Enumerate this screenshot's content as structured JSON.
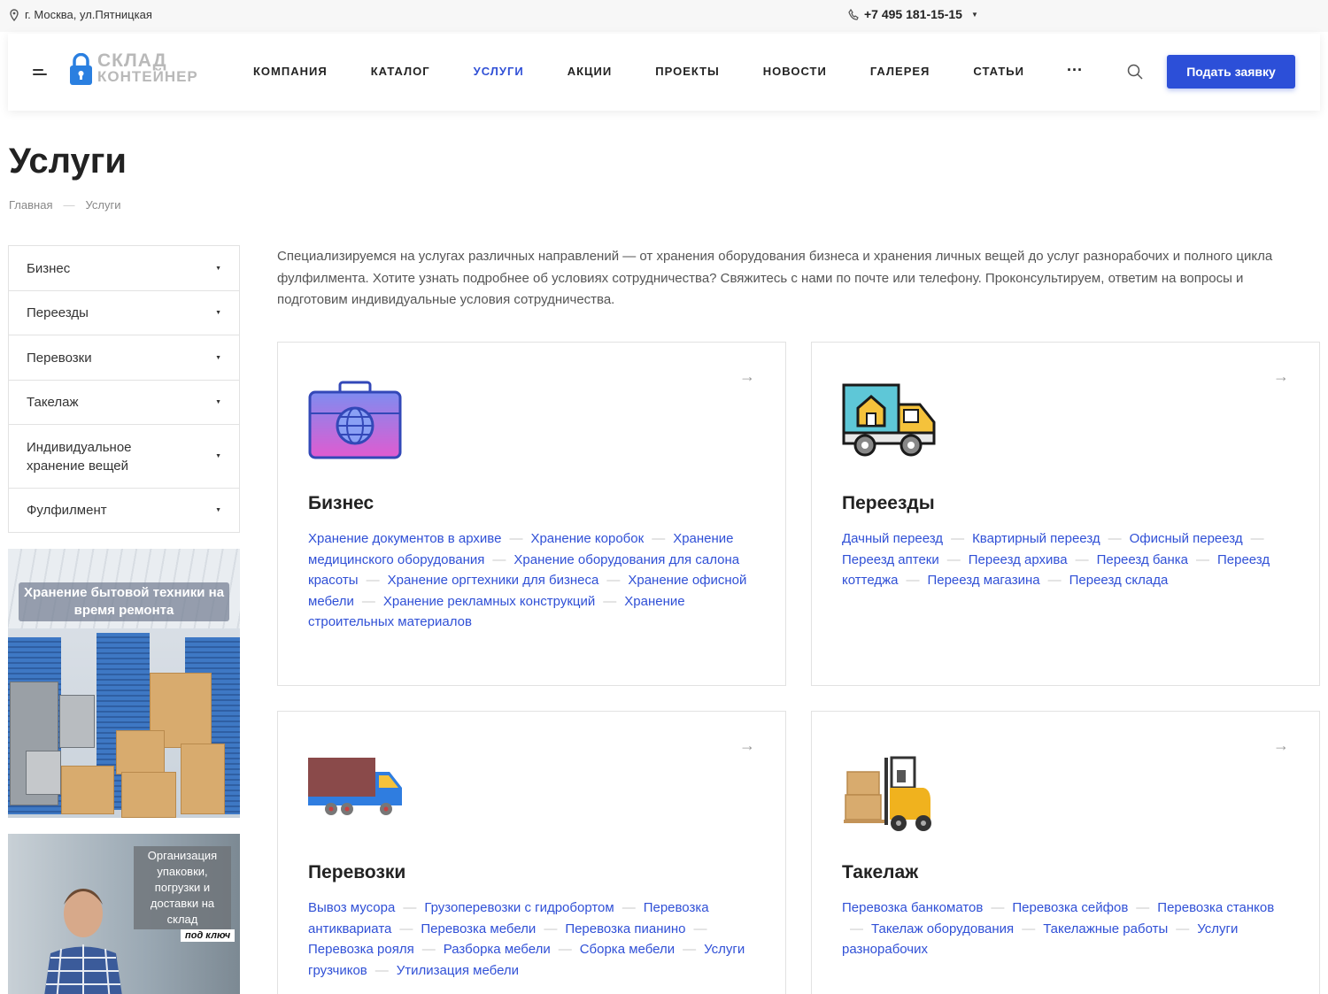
{
  "topbar": {
    "address": "г. Москва, ул.Пятницкая",
    "phone": "+7 495 181-15-15"
  },
  "header": {
    "logo_line1": "СКЛАД",
    "logo_line2": "КОНТЕЙНЕР",
    "nav": [
      "КОМПАНИЯ",
      "КАТАЛОГ",
      "УСЛУГИ",
      "АКЦИИ",
      "ПРОЕКТЫ",
      "НОВОСТИ",
      "ГАЛЕРЕЯ",
      "СТАТЬИ"
    ],
    "nav_active": "УСЛУГИ",
    "more": "···",
    "cta": "Подать заявку"
  },
  "page": {
    "title": "Услуги",
    "breadcrumbs": [
      "Главная",
      "Услуги"
    ]
  },
  "sidebar": {
    "items": [
      "Бизнес",
      "Переезды",
      "Перевозки",
      "Такелаж",
      "Индивидуальное хранение вещей",
      "Фулфилмент"
    ]
  },
  "banners": {
    "b1_caption": "Хранение бытовой техники на время ремонта",
    "b2_caption": "Организация упаковки, погрузки и доставки на склад",
    "b2_tag": "под ключ"
  },
  "intro": "Специализируемся на услугах различных направлений — от хранения оборудования бизнеса и хранения личных вещей до услуг разнорабочих и полного цикла фулфилмента. Хотите узнать подробнее об условиях сотрудничества? Свяжитесь с нами по почте или телефону. Проконсультируем, ответим на вопросы и подготовим индивидуальные условия сотрудничества.",
  "cards": [
    {
      "title": "Бизнес",
      "icon": "briefcase-globe-icon",
      "links": [
        "Хранение документов в архиве",
        "Хранение коробок",
        "Хранение медицинского оборудования",
        "Хранение оборудования для салона красоты",
        "Хранение оргтехники для бизнеса",
        "Хранение офисной мебели",
        "Хранение рекламных конструкций",
        "Хранение строительных материалов"
      ]
    },
    {
      "title": "Переезды",
      "icon": "moving-truck-icon",
      "links": [
        "Дачный переезд",
        "Квартирный переезд",
        "Офисный переезд",
        "Переезд аптеки",
        "Переезд архива",
        "Переезд банка",
        "Переезд коттеджа",
        "Переезд магазина",
        "Переезд склада"
      ]
    },
    {
      "title": "Перевозки",
      "icon": "cargo-truck-icon",
      "links": [
        "Вывоз мусора",
        "Грузоперевозки с гидробортом",
        "Перевозка антиквариата",
        "Перевозка мебели",
        "Перевозка пианино",
        "Перевозка рояля",
        "Разборка мебели",
        "Сборка мебели",
        "Услуги грузчиков",
        "Утилизация мебели"
      ]
    },
    {
      "title": "Такелаж",
      "icon": "forklift-icon",
      "links": [
        "Перевозка банкоматов",
        "Перевозка сейфов",
        "Перевозка станков",
        "Такелаж оборудования",
        "Такелажные работы",
        "Услуги разнорабочих"
      ]
    }
  ],
  "colors": {
    "accent": "#2c4fd8",
    "link": "#3050d6"
  }
}
